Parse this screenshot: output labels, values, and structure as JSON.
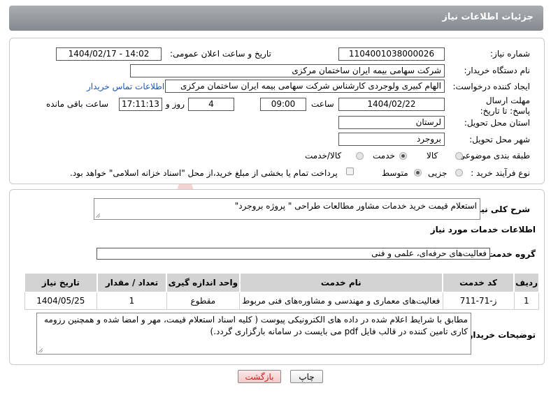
{
  "header": {
    "title": "جزئیات اطلاعات نیاز"
  },
  "form": {
    "need_number_label": "شماره نیاز:",
    "need_number": "1104001038000026",
    "announce_label": "تاریخ و ساعت اعلان عمومی:",
    "announce_value": "1404/02/17 - 14:02",
    "buyer_org_label": "نام دستگاه خریدار:",
    "buyer_org": "شرکت سهامی بیمه ایران ساختمان مرکزی",
    "creator_label": "ایجاد کننده درخواست:",
    "creator": "الهام کبیری ولوجردی کارشناس شرکت سهامی بیمه ایران ساختمان مرکزی",
    "contact_link": "اطلاعات تماس خریدار",
    "deadline_label": "مهلت ارسال پاسخ: تا تاریخ:",
    "deadline_date": "1404/02/22",
    "time_label": "ساعت",
    "deadline_time": "09:00",
    "days_value": "4",
    "days_label": "روز و",
    "remaining_time": "17:11:13",
    "remaining_label": "ساعت باقی مانده",
    "province_label": "استان محل تحویل:",
    "province": "لرستان",
    "city_label": "شهر محل تحویل:",
    "city": "بروجرد",
    "category_label": "طبقه بندی موضوعی:",
    "category_options": [
      "کالا",
      "خدمت",
      "کالا/خدمت"
    ],
    "category_selected": "خدمت",
    "process_label": "نوع فرآیند خرید :",
    "process_options": [
      "جزیی",
      "متوسط"
    ],
    "process_selected": "متوسط",
    "payment_note": "پرداخت تمام یا بخشی از مبلغ خرید،از محل \"اسناد خزانه اسلامی\" خواهد بود."
  },
  "description": {
    "label": "شرح کلی نیاز:",
    "text": "استعلام قیمت خرید خدمات مشاور مطالعات طراحی \" پروژه بروجرد\""
  },
  "services": {
    "section_title": "اطلاعات خدمات مورد نیاز",
    "group_label": "گروه خدمت:",
    "group_value": "فعالیت‌های حرفه‌ای، علمی و فنی",
    "columns": [
      "ردیف",
      "کد خدمت",
      "نام خدمت",
      "واحد اندازه گیری",
      "تعداد / مقدار",
      "تاریخ نیاز"
    ],
    "rows": [
      [
        "1",
        "ز-71-711",
        "فعالیت‌های معماری و مهندسی و مشاوره‌های فنی مربوط",
        "مقطوع",
        "1",
        "1404/05/25"
      ]
    ]
  },
  "buyer_notes": {
    "label": "توضیحات خریدار:",
    "text": "مطابق با شرایط اعلام شده در داده های الکترونیکی پیوست ( کلیه اسناد استعلام قیمت، مهر و امضا شده و همچنین رزومه کاری تامین کننده در قالب فایل pdf می بایست در سامانه بارگزاری گردد.)"
  },
  "buttons": {
    "print": "چاپ",
    "back": "بازگشت"
  },
  "watermark": {
    "text": "AriaTender.neT"
  },
  "colors": {
    "header": "#8f9499",
    "link": "#1a57b8",
    "back_button_text": "#d01818",
    "watermark": "#f0c6c6"
  }
}
